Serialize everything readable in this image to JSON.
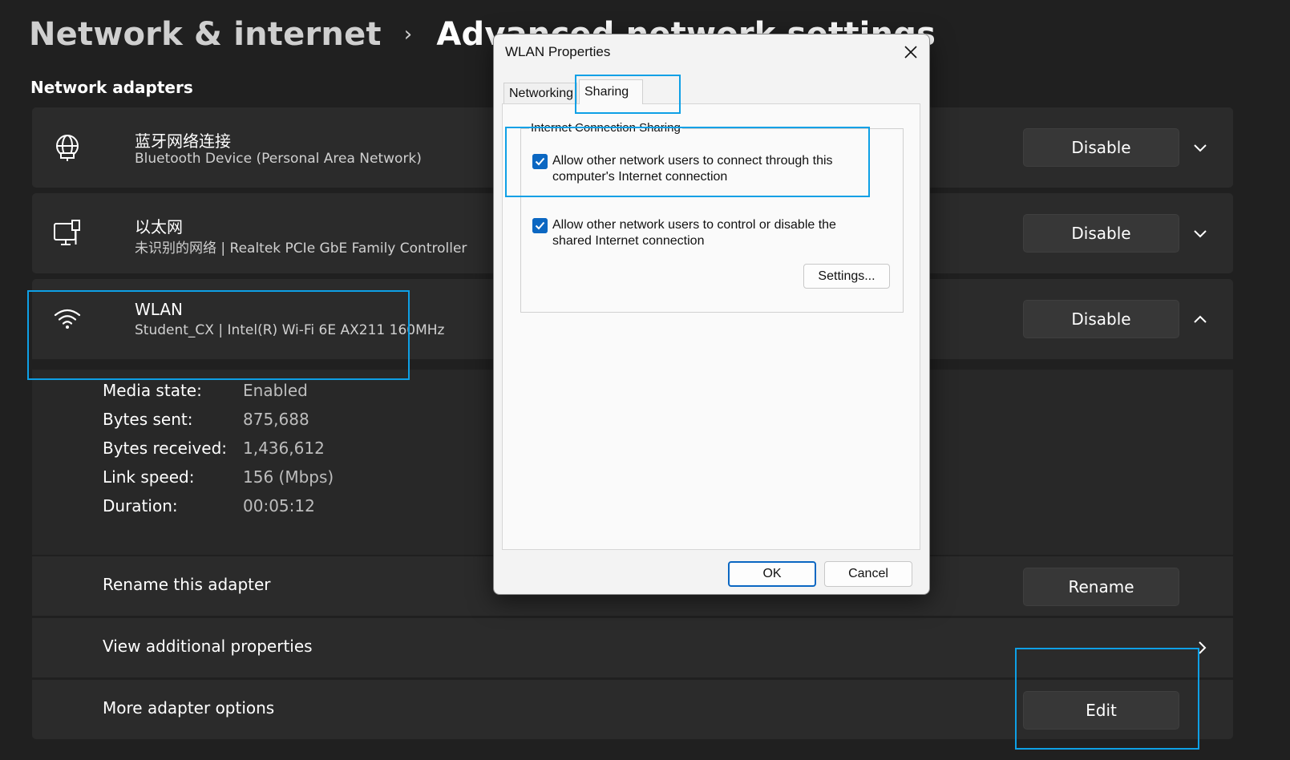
{
  "breadcrumb": {
    "parent": "Network & internet",
    "separator": "›",
    "current": "Advanced network settings"
  },
  "section_title": "Network adapters",
  "adapters": [
    {
      "name": "蓝牙网络连接",
      "description": "Bluetooth Device (Personal Area Network)",
      "button": "Disable",
      "icon": "globe-network-icon"
    },
    {
      "name": "以太网",
      "description": "未识别的网络 | Realtek PCIe GbE Family Controller",
      "button": "Disable",
      "icon": "ethernet-pc-icon"
    },
    {
      "name": "WLAN",
      "description": "Student_CX | Intel(R) Wi-Fi 6E AX211 160MHz",
      "button": "Disable",
      "icon": "wifi-icon"
    }
  ],
  "wlan_details": [
    {
      "key": "Media state:",
      "value": "Enabled"
    },
    {
      "key": "Bytes sent:",
      "value": "875,688"
    },
    {
      "key": "Bytes received:",
      "value": "1,436,612"
    },
    {
      "key": "Link speed:",
      "value": "156 (Mbps)"
    },
    {
      "key": "Duration:",
      "value": "00:05:12"
    }
  ],
  "rows": {
    "rename_label": "Rename this adapter",
    "rename_button": "Rename",
    "view_props_label": "View additional properties",
    "more_options_label": "More adapter options",
    "edit_button": "Edit"
  },
  "dialog": {
    "title": "WLAN Properties",
    "tabs": [
      "Networking",
      "Sharing"
    ],
    "active_tab": "Sharing",
    "group_title": "Internet Connection Sharing",
    "checkbox1": "Allow other network users to connect through this computer's Internet connection",
    "checkbox1_checked": true,
    "checkbox2": "Allow other network users to control or disable the shared Internet connection",
    "checkbox2_checked": true,
    "settings_button": "Settings...",
    "ok_button": "OK",
    "cancel_button": "Cancel"
  },
  "colors": {
    "background": "#202020",
    "card": "#2b2b2b",
    "highlight": "#0ea0e6",
    "checkbox": "#0b67c2"
  }
}
